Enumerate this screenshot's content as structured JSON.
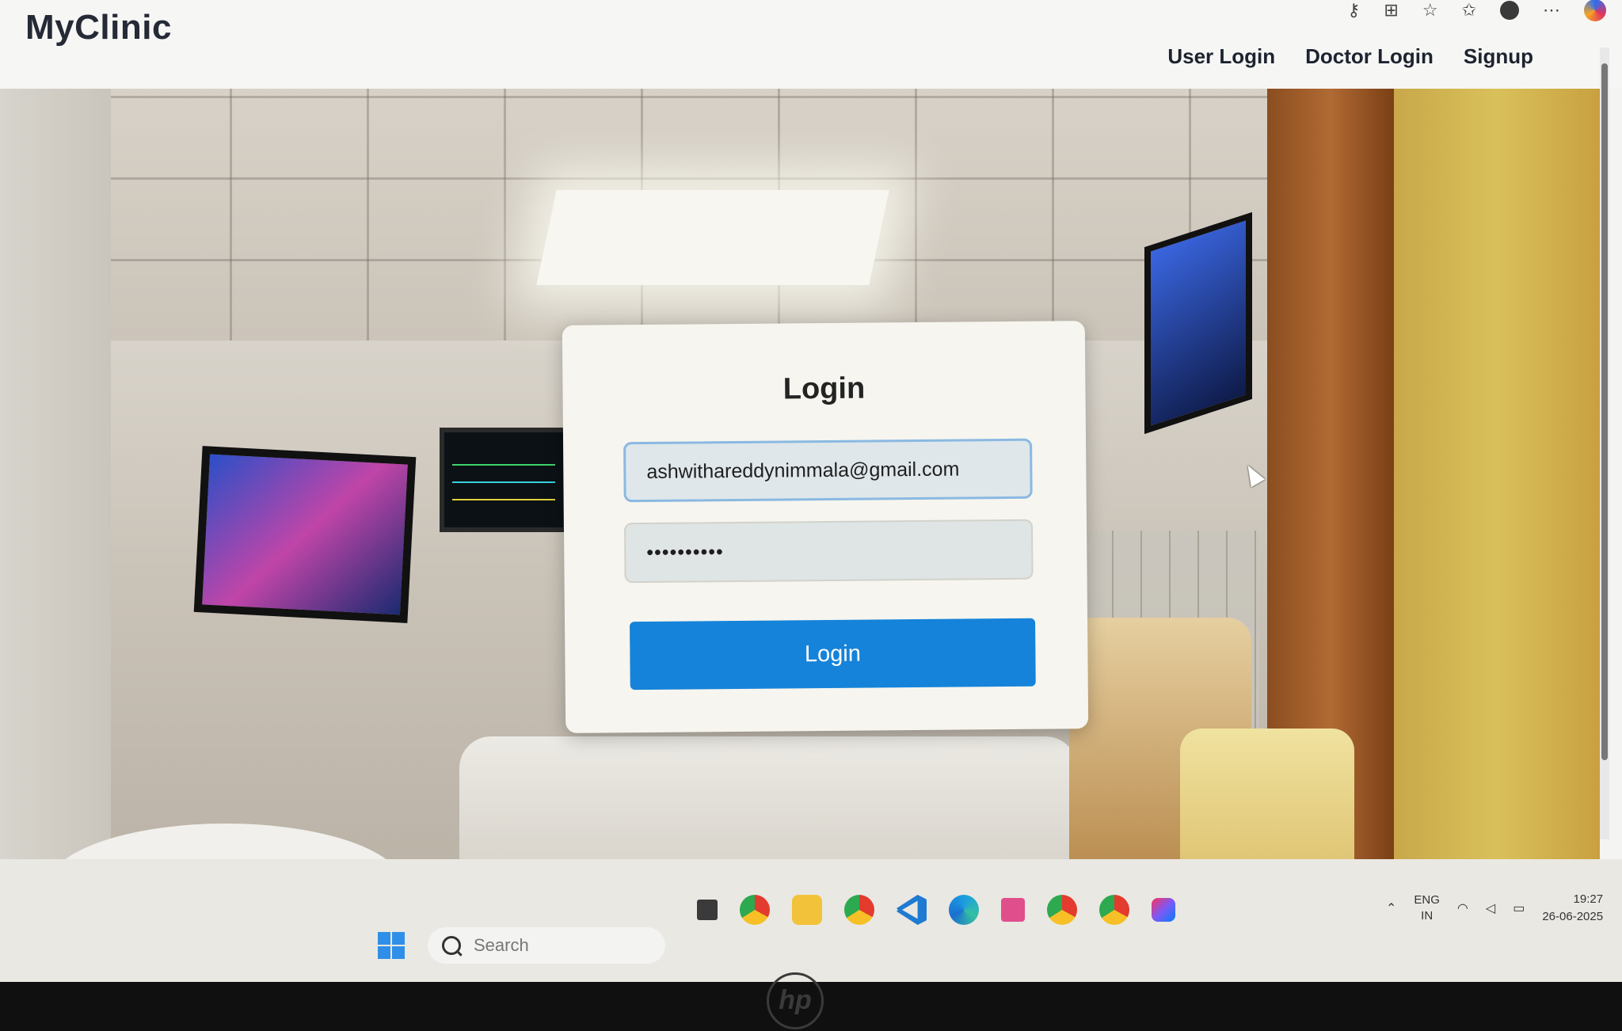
{
  "app": {
    "brand": "MyClinic"
  },
  "nav": {
    "links": [
      "User Login",
      "Doctor Login",
      "Signup"
    ]
  },
  "login": {
    "title": "Login",
    "email_value": "ashwithareddynimmala@gmail.com",
    "password_mask": "••••••••••",
    "button_label": "Login"
  },
  "taskbar": {
    "search_placeholder": "Search",
    "apps": [
      "chrome-icon",
      "file-explorer-icon",
      "chrome-profile-icon",
      "vscode-icon",
      "edge-icon",
      "snipping-tool-icon",
      "chrome-profile-2-icon",
      "chrome-profile-3-icon",
      "intellij-icon"
    ],
    "lang_line1": "ENG",
    "lang_line2": "IN",
    "time": "19:27",
    "date": "26-06-2025"
  },
  "colors": {
    "primary_button": "#1583d9",
    "input_focus_border": "#8ab9e2"
  },
  "device": {
    "brand_logo": "hp"
  }
}
